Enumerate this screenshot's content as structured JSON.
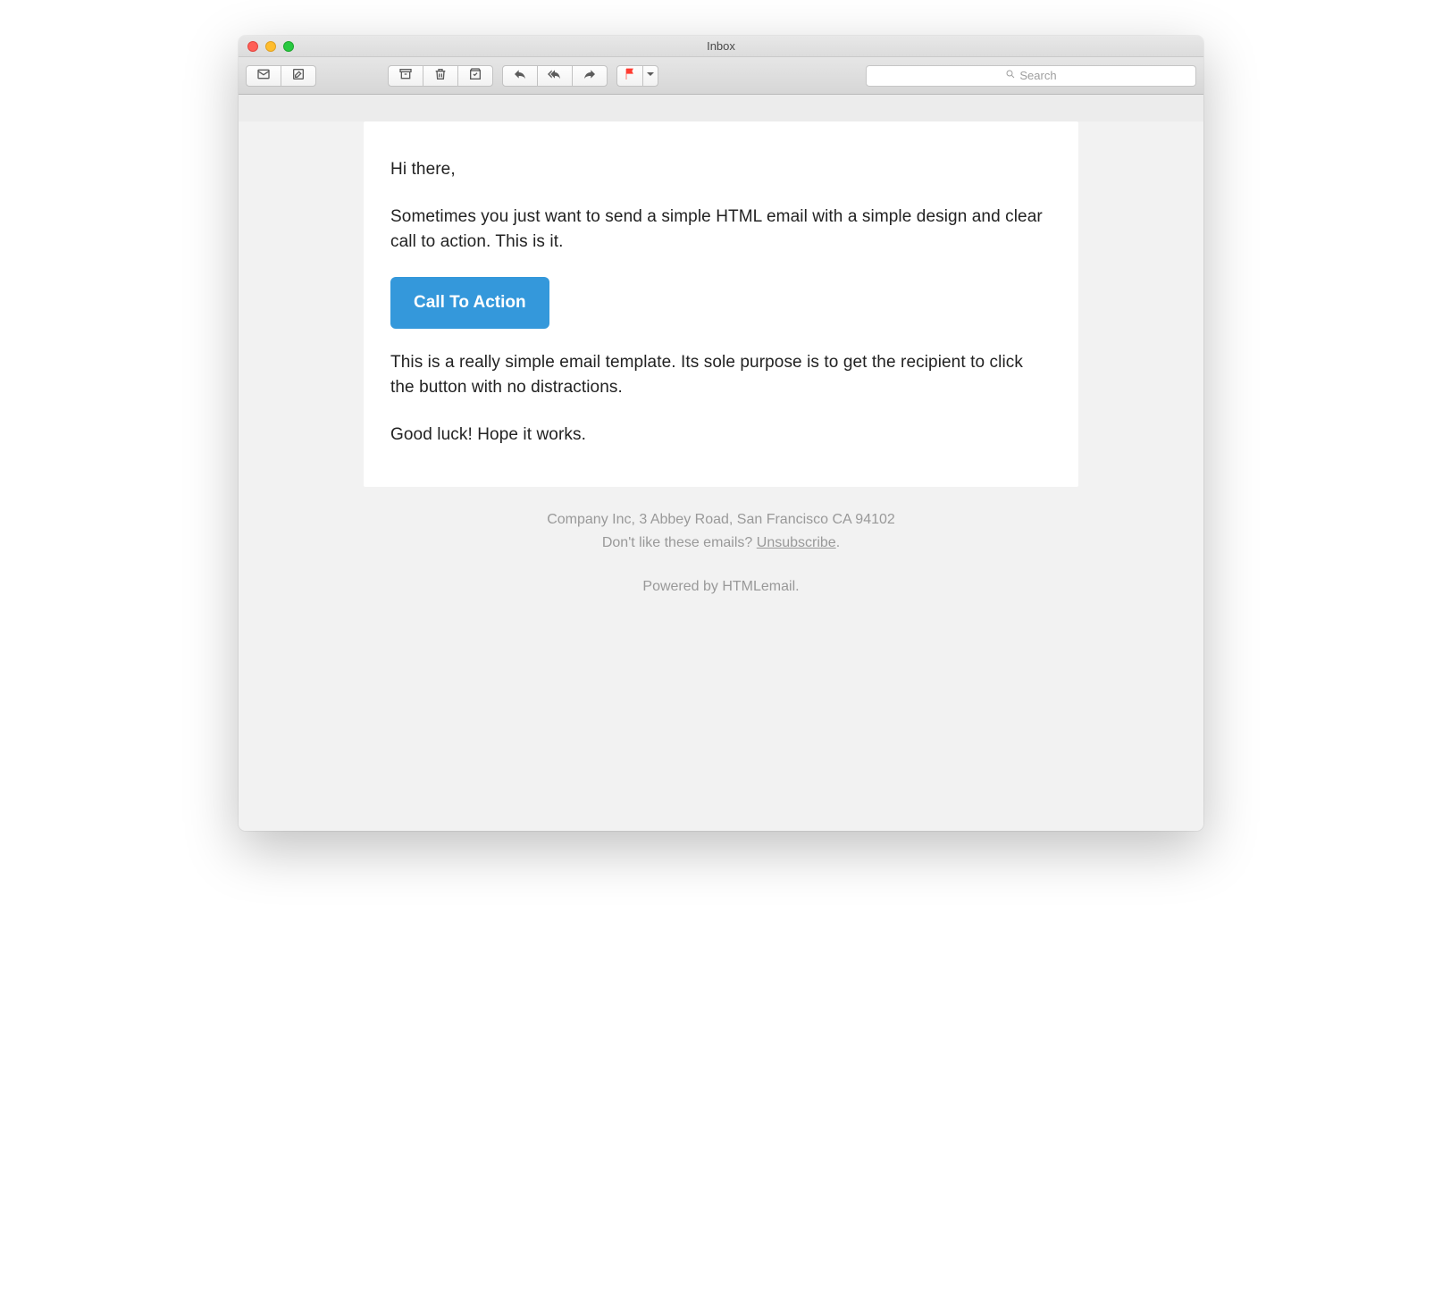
{
  "window": {
    "title": "Inbox"
  },
  "search": {
    "placeholder": "Search"
  },
  "email": {
    "greeting": "Hi there,",
    "intro": "Sometimes you just want to send a simple HTML email with a simple design and clear call to action. This is it.",
    "cta_label": "Call To Action",
    "body": "This is a really simple email template. Its sole purpose is to get the recipient to click the button with no distractions.",
    "closing": "Good luck! Hope it works."
  },
  "footer": {
    "company": "Company Inc, 3 Abbey Road, San Francisco CA 94102",
    "unsub_prefix": "Don't like these emails? ",
    "unsub_link": "Unsubscribe",
    "unsub_suffix": ".",
    "powered": "Powered by HTMLemail."
  }
}
